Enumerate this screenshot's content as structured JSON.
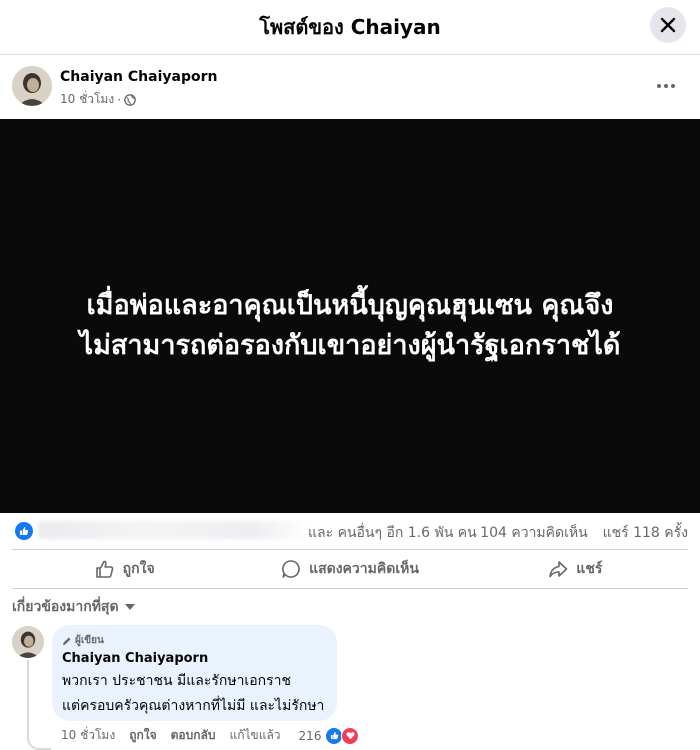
{
  "header": {
    "title": "โพสต์ของ Chaiyan"
  },
  "post": {
    "author": "Chaiyan Chaiyaporn",
    "time": "10 ชั่วโมง",
    "separator": "·",
    "image_text_line1": "เมื่อพ่อและอาคุณเป็นหนี้บุญคุณฮุนเซน คุณจึง",
    "image_text_line2": "ไม่สามารถต่อรองกับเขาอย่างผู้นำรัฐเอกราชได้"
  },
  "stats": {
    "others_text": "และ คนอื่นๆ อีก 1.6 พัน คน",
    "comments_text": "104 ความคิดเห็น",
    "shares_text": "แชร์ 118 ครั้ง"
  },
  "actions": {
    "like": "ถูกใจ",
    "comment": "แสดงความคิดเห็น",
    "share": "แชร์"
  },
  "filter": {
    "label": "เกี่ยวข้องมากที่สุด"
  },
  "comment": {
    "badge": "ผู้เขียน",
    "name": "Chaiyan Chaiyaporn",
    "line1": "พวกเรา ประชาชน มีและรักษาเอกราช",
    "line2": "แต่ครอบครัวคุณต่างหากที่ไม่มี และไม่รักษา",
    "time": "10 ชั่วโมง",
    "like": "ถูกใจ",
    "reply": "ตอบกลับ",
    "edited": "แก้ไขแล้ว",
    "reaction_count": "216"
  },
  "colors": {
    "accent": "#1877f2",
    "love": "#f33e58",
    "muted_text": "#65676b",
    "comment_bubble": "#eaf2fe",
    "image_bg": "#0a0a0a"
  },
  "icons": [
    "close-icon",
    "globe-icon",
    "more-icon",
    "like-icon",
    "comment-icon",
    "share-icon",
    "chevron-down-icon",
    "pencil-icon",
    "love-icon"
  ]
}
